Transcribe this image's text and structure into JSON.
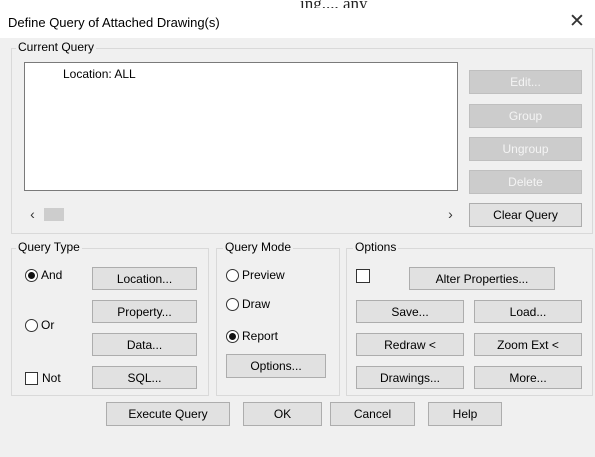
{
  "background": {
    "title": "ing..., any"
  },
  "window": {
    "title": "Define Query of Attached Drawing(s)",
    "close_glyph": "✕"
  },
  "current_query": {
    "group_label": "Current Query",
    "lines": [
      "Location: ALL"
    ],
    "scroll_left": "‹",
    "scroll_right": "›",
    "buttons": {
      "edit": "Edit...",
      "group": "Group",
      "ungroup": "Ungroup",
      "delete": "Delete",
      "clear": "Clear Query"
    }
  },
  "query_type": {
    "group_label": "Query Type",
    "and_label": "And",
    "or_label": "Or",
    "not_label": "Not",
    "selected": "And",
    "buttons": {
      "location": "Location...",
      "property": "Property...",
      "data": "Data...",
      "sql": "SQL..."
    }
  },
  "query_mode": {
    "group_label": "Query Mode",
    "preview_label": "Preview",
    "draw_label": "Draw",
    "report_label": "Report",
    "selected": "Report",
    "options_button": "Options..."
  },
  "options": {
    "group_label": "Options",
    "alter_properties": "Alter Properties...",
    "save": "Save...",
    "load": "Load...",
    "redraw": "Redraw <",
    "zoom_ext": "Zoom Ext <",
    "drawings": "Drawings...",
    "more": "More..."
  },
  "footer": {
    "execute": "Execute Query",
    "ok": "OK",
    "cancel": "Cancel",
    "help": "Help"
  }
}
